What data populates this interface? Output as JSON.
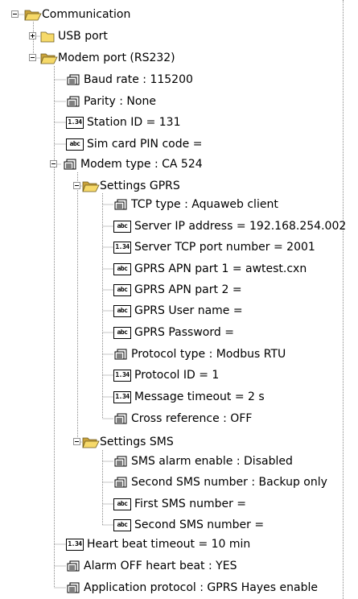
{
  "tree": {
    "communication": {
      "label": "Communication",
      "usb_port": {
        "label": "USB port"
      },
      "modem_port": {
        "label": "Modem port (RS232)",
        "baud_rate": "Baud rate : 115200",
        "parity": "Parity : None",
        "station_id": "Station ID = 131",
        "sim_pin": "Sim card PIN code =",
        "modem_type": {
          "label": "Modem type : CA 524",
          "settings_gprs": {
            "label": "Settings GPRS",
            "items": [
              "TCP type : Aquaweb client",
              "Server IP address = 192.168.254.002",
              "Server TCP port number = 2001",
              "GPRS APN part 1 = awtest.cxn",
              "GPRS APN part 2 =",
              "GPRS User name =",
              "GPRS Password =",
              "Protocol type : Modbus RTU",
              "Protocol ID = 1",
              "Message timeout = 2 s",
              "Cross reference : OFF"
            ]
          },
          "settings_sms": {
            "label": "Settings SMS",
            "items": [
              "SMS alarm enable : Disabled",
              "Second SMS number : Backup only",
              "First SMS number =",
              "Second SMS number ="
            ]
          }
        },
        "heart_beat_timeout": "Heart beat timeout = 10 min",
        "alarm_off_heart_beat": "Alarm OFF heart beat : YES",
        "application_protocol": "Application protocol : GPRS Hayes enable"
      }
    }
  },
  "badges": {
    "numeric": "1.34",
    "text": "abc"
  },
  "icons": {
    "folder": "folder-icon",
    "folder_open": "folder-open-icon",
    "list": "list-icon",
    "numeric": "numeric-value-icon",
    "text": "text-value-icon"
  },
  "colors": {
    "folder_yellow": "#f6d969",
    "folder_dark": "#c9a23a",
    "tree_line": "#8a8a8a"
  }
}
